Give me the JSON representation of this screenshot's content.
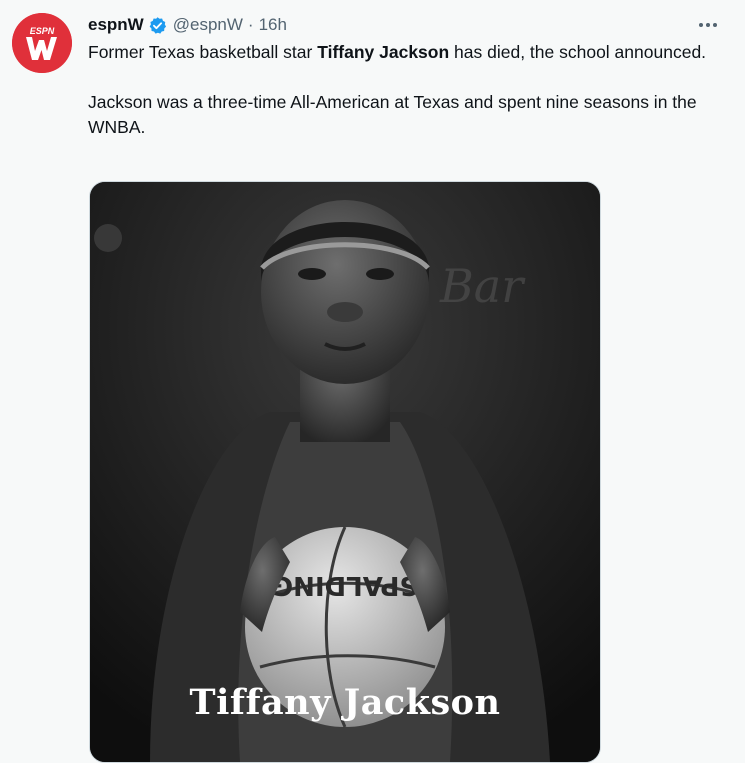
{
  "tweet": {
    "avatar_icon": "espnw-logo",
    "avatar_logo_text": "ESPN",
    "display_name": "espnW",
    "verified_icon": "verified-badge-icon",
    "handle": "@espnW",
    "separator": "·",
    "time": "16h",
    "more_icon": "more-icon",
    "more_label": "···",
    "text_p1_before": "Former Texas basketball star ",
    "text_p1_bold": "Tiffany Jackson",
    "text_p1_after": " has died, the school announced.",
    "text_p2": "Jackson was a three-time All-American at Texas and spent nine seasons in the WNBA.",
    "media": {
      "caption": "Tiffany Jackson",
      "ball_brand": "SPALDING"
    }
  },
  "colors": {
    "background": "#f7f9f9",
    "text": "#0f1419",
    "secondary_text": "#536471",
    "verified_blue": "#1d9bf0",
    "avatar_red": "#e0303a"
  }
}
